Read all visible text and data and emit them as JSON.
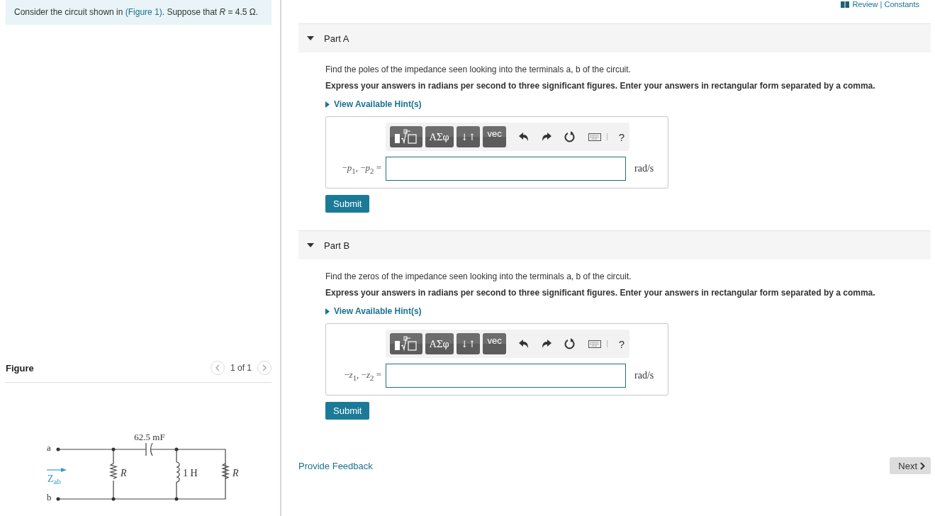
{
  "header_link": "Review | Constants",
  "intro": {
    "before": "Consider the circuit shown in ",
    "link": "(Figure 1)",
    "after": ". Suppose that *R* = 4.5 Ω."
  },
  "figure": {
    "title": "Figure",
    "pager": "1 of 1",
    "capacitor": "62.5 mF",
    "resistor_left": "R",
    "inductor": "1 H",
    "resistor_right": "R",
    "terminal_a": "a",
    "terminal_b": "b",
    "impedance": {
      "main": "Z",
      "sub": "ab"
    }
  },
  "parts": [
    {
      "title": "Part A",
      "expanded": true,
      "prompt": "Find the poles of the impedance seen looking into the terminals a, b of the circuit.",
      "instructions": "Express your answers in radians per second to three significant figures. Enter your answers in rectangular form separated by a comma.",
      "hint": "View Available Hint(s)",
      "toolbar": [
        {
          "kind": "templates"
        },
        {
          "kind": "text",
          "label": "ΑΣφ"
        },
        {
          "kind": "text",
          "label": "↓↑"
        },
        {
          "kind": "text",
          "label": "vec"
        },
        {
          "kind": "undo"
        },
        {
          "kind": "redo"
        },
        {
          "kind": "reset"
        },
        {
          "kind": "keyboard"
        },
        {
          "kind": "help",
          "label": "?"
        }
      ],
      "answer_label": "−*p*$_{1}$, −*p*$_{2}$ =",
      "unit": "rad/s",
      "submit": "Submit"
    },
    {
      "title": "Part B",
      "expanded": true,
      "prompt": "Find the zeros of the impedance seen looking into the terminals a, b of the circuit.",
      "instructions": "Express your answers in radians per second to three significant figures. Enter your answers in rectangular form separated by a comma.",
      "hint": "View Available Hint(s)",
      "toolbar": [
        {
          "kind": "templates"
        },
        {
          "kind": "text",
          "label": "ΑΣφ"
        },
        {
          "kind": "text",
          "label": "↓↑"
        },
        {
          "kind": "text",
          "label": "vec"
        },
        {
          "kind": "undo"
        },
        {
          "kind": "redo"
        },
        {
          "kind": "reset"
        },
        {
          "kind": "keyboard"
        },
        {
          "kind": "help",
          "label": "?"
        }
      ],
      "answer_label": "−*z*$_{1}$, −*z*$_{2}$ =",
      "unit": "rad/s",
      "submit": "Submit"
    }
  ],
  "feedback_link": "Provide Feedback",
  "next_button": "Next"
}
